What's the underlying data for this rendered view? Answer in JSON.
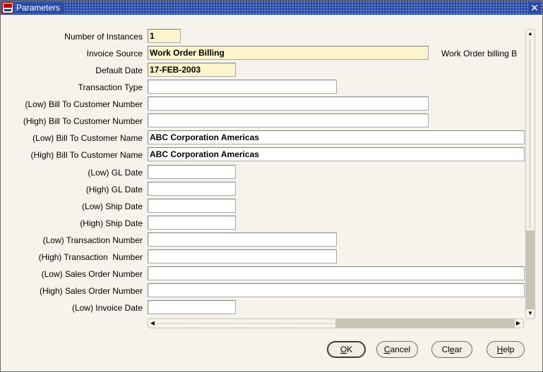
{
  "window": {
    "title": "Parameters",
    "close_glyph": "✕"
  },
  "fields": [
    {
      "label": "Number of Instances",
      "value": "1",
      "required": true
    },
    {
      "label": "Invoice Source",
      "value": "Work Order Billing",
      "required": true,
      "description": "Work Order billing B"
    },
    {
      "label": "Default Date",
      "value": "17-FEB-2003",
      "required": true
    },
    {
      "label": "Transaction Type",
      "value": "",
      "required": false
    },
    {
      "label": "(Low) Bill To Customer Number",
      "value": "",
      "required": false
    },
    {
      "label": "(High) Bill To Customer Number",
      "value": "",
      "required": false
    },
    {
      "label": "(Low) Bill To Customer Name",
      "value": "ABC Corporation Americas",
      "required": false
    },
    {
      "label": "(High) Bill To Customer Name",
      "value": "ABC Corporation Americas",
      "required": false
    },
    {
      "label": "(Low) GL Date",
      "value": "",
      "required": false
    },
    {
      "label": "(High) GL Date",
      "value": "",
      "required": false
    },
    {
      "label": "(Low) Ship Date",
      "value": "",
      "required": false
    },
    {
      "label": "(High) Ship Date",
      "value": "",
      "required": false
    },
    {
      "label": "(Low) Transaction Number",
      "value": "",
      "required": false
    },
    {
      "label": "(High) Transaction  Number",
      "value": "",
      "required": false
    },
    {
      "label": "(Low) Sales Order Number",
      "value": "",
      "required": false
    },
    {
      "label": "(High) Sales Order Number",
      "value": "",
      "required": false
    },
    {
      "label": "(Low) Invoice Date",
      "value": "",
      "required": false
    }
  ],
  "buttons": {
    "ok": {
      "mnemonic": "O",
      "rest": "K"
    },
    "cancel": {
      "mnemonic": "C",
      "rest": "ancel"
    },
    "clear": {
      "pre": "Cl",
      "mnemonic": "e",
      "rest": "ar"
    },
    "help": {
      "mnemonic": "H",
      "rest": "elp"
    }
  },
  "colors": {
    "title_bar": "#2a4ca6",
    "required_field": "#fcf4cc",
    "window_background": "#f5f3ec"
  },
  "icons": {
    "app": "oracle-app-icon",
    "close": "close-icon"
  }
}
